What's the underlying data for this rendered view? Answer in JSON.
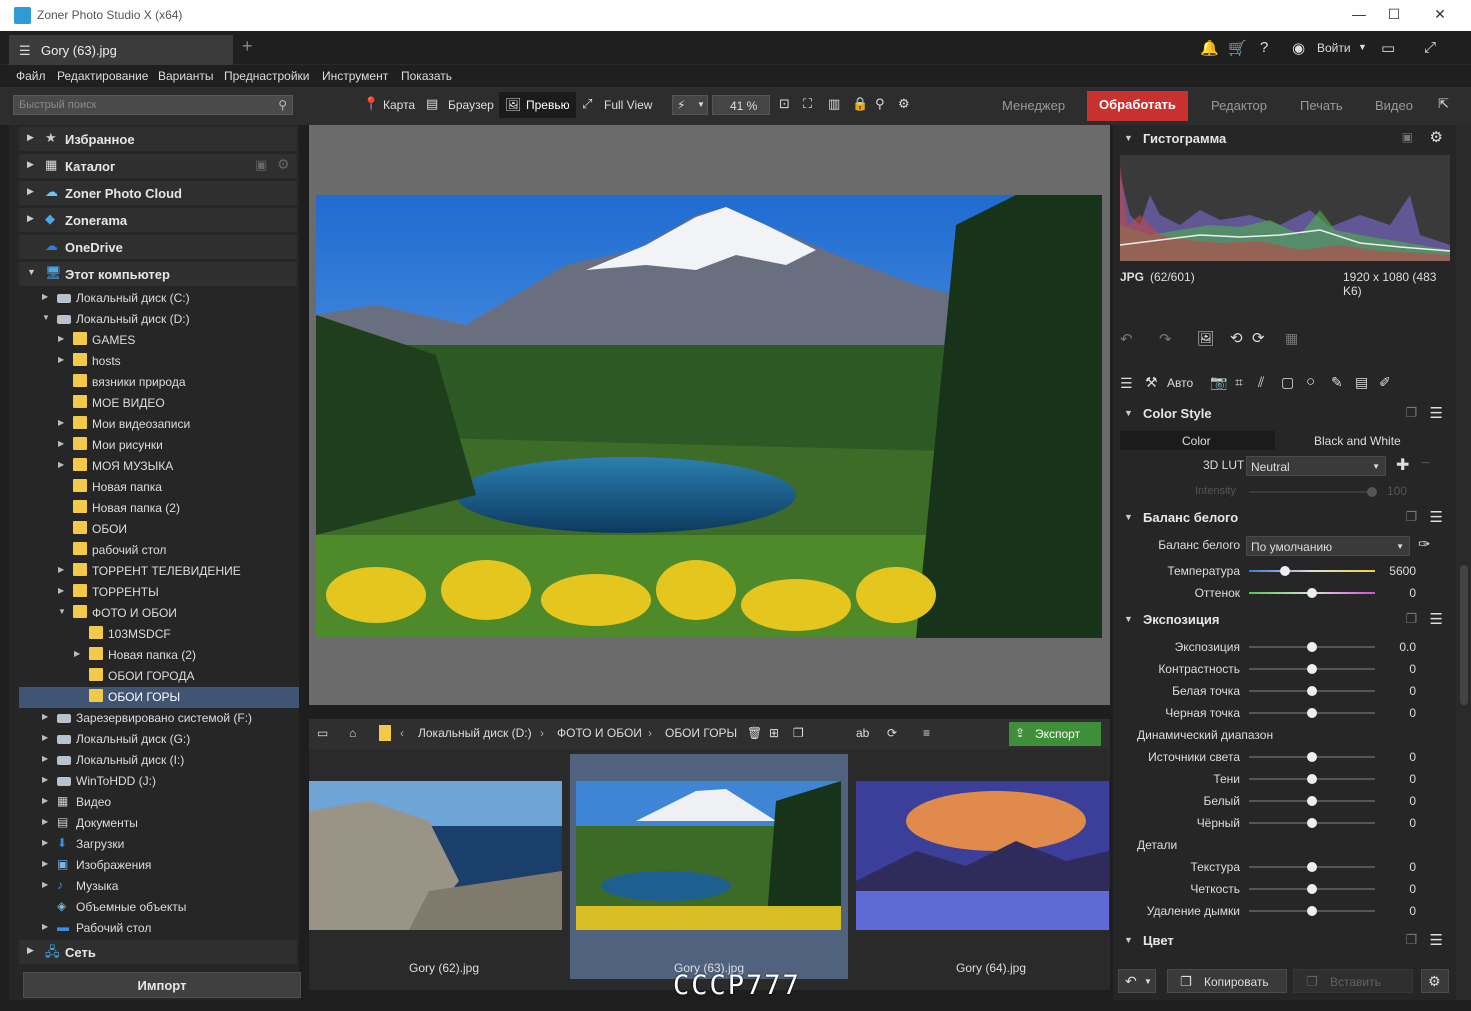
{
  "window": {
    "title": "Zoner Photo Studio X (x64)",
    "minimize": "—",
    "maximize": "☐",
    "close": "✕"
  },
  "tabs": {
    "active_label": "Gory (63).jpg",
    "add": "+"
  },
  "topbar": {
    "login": "Войти"
  },
  "menu": [
    "Файл",
    "Редактирование",
    "Варианты",
    "Преднастройки",
    "Инструмент",
    "Показать"
  ],
  "toolbar": {
    "search_placeholder": "Быстрый поиск",
    "views": [
      "Карта",
      "Браузер",
      "Превью",
      "Full View"
    ],
    "zoom": "41 %",
    "modes": [
      "Менеджер",
      "Обработать",
      "Редактор",
      "Печать",
      "Видео"
    ],
    "active_mode": "Обработать"
  },
  "left": {
    "favorites": "Избранное",
    "catalog": "Каталог",
    "cloud": "Zoner Photo Cloud",
    "zonerama": "Zonerama",
    "onedrive": "OneDrive",
    "computer": "Этот компьютер",
    "items": [
      "Локальный диск (C:)",
      "Локальный диск (D:)",
      "GAMES",
      "hosts",
      "вязники природа",
      "МОЕ ВИДЕО",
      "Мои видеозаписи",
      "Мои рисунки",
      "МОЯ МУЗЫКА",
      "Новая папка",
      "Новая папка (2)",
      "ОБОИ",
      "рабочий стол",
      "ТОРРЕНТ ТЕЛЕВИДЕНИЕ",
      "ТОРРЕНТЫ",
      "ФОТО И ОБОИ",
      "103MSDCF",
      "Новая папка (2)",
      "ОБОИ ГОРОДА",
      "ОБОИ ГОРЫ",
      "Зарезервировано системой (F:)",
      "Локальный диск (G:)",
      "Локальный диск (I:)",
      "WinToHDD (J:)",
      "Видео",
      "Документы",
      "Загрузки",
      "Изображения",
      "Музыка",
      "Объемные объекты",
      "Рабочий стол"
    ],
    "network": "Сеть",
    "import": "Импорт"
  },
  "browser": {
    "path": [
      "Локальный диск (D:)",
      "ФОТО И ОБОИ",
      "ОБОИ ГОРЫ"
    ],
    "export": "Экспорт",
    "thumbs": [
      "Gory (62).jpg",
      "Gory (63).jpg",
      "Gory (64).jpg"
    ],
    "watermark": "СССР777"
  },
  "right": {
    "histogram": "Гистограмма",
    "file_type": "JPG",
    "file_index": "(62/601)",
    "file_dims": "1920 x 1080 (483 K6)",
    "auto": "Авто",
    "color_style": "Color Style",
    "cs_tabs": [
      "Color",
      "Black and White"
    ],
    "lut_label": "3D LUT",
    "lut_value": "Neutral",
    "intensity_label": "Intensity",
    "intensity_value": "100",
    "wb_section": "Баланс белого",
    "wb_label": "Баланс белого",
    "wb_value": "По умолчанию",
    "temp_label": "Температура",
    "temp_value": "5600",
    "temp_fraction": 0.27,
    "tint_label": "Оттенок",
    "tint_value": "0",
    "exposure_section": "Экспозиция",
    "exposure_rows": [
      {
        "label": "Экспозиция",
        "value": "0.0"
      },
      {
        "label": "Контрастность",
        "value": "0"
      },
      {
        "label": "Белая точка",
        "value": "0"
      },
      {
        "label": "Черная точка",
        "value": "0"
      }
    ],
    "dynamic_range": "Динамический диапазон",
    "dynamic_rows": [
      {
        "label": "Источники света",
        "value": "0"
      },
      {
        "label": "Тени",
        "value": "0"
      },
      {
        "label": "Белый",
        "value": "0"
      },
      {
        "label": "Чёрный",
        "value": "0"
      }
    ],
    "details": "Детали",
    "detail_rows": [
      {
        "label": "Текстура",
        "value": "0"
      },
      {
        "label": "Четкость",
        "value": "0"
      },
      {
        "label": "Удаление дымки",
        "value": "0"
      }
    ],
    "color_section": "Цвет",
    "copy_btn": "Копировать",
    "paste_btn": "Вставить"
  },
  "colors": {
    "accent": "#c8312f",
    "export": "#3f8f3a",
    "selection": "#3f5573"
  }
}
